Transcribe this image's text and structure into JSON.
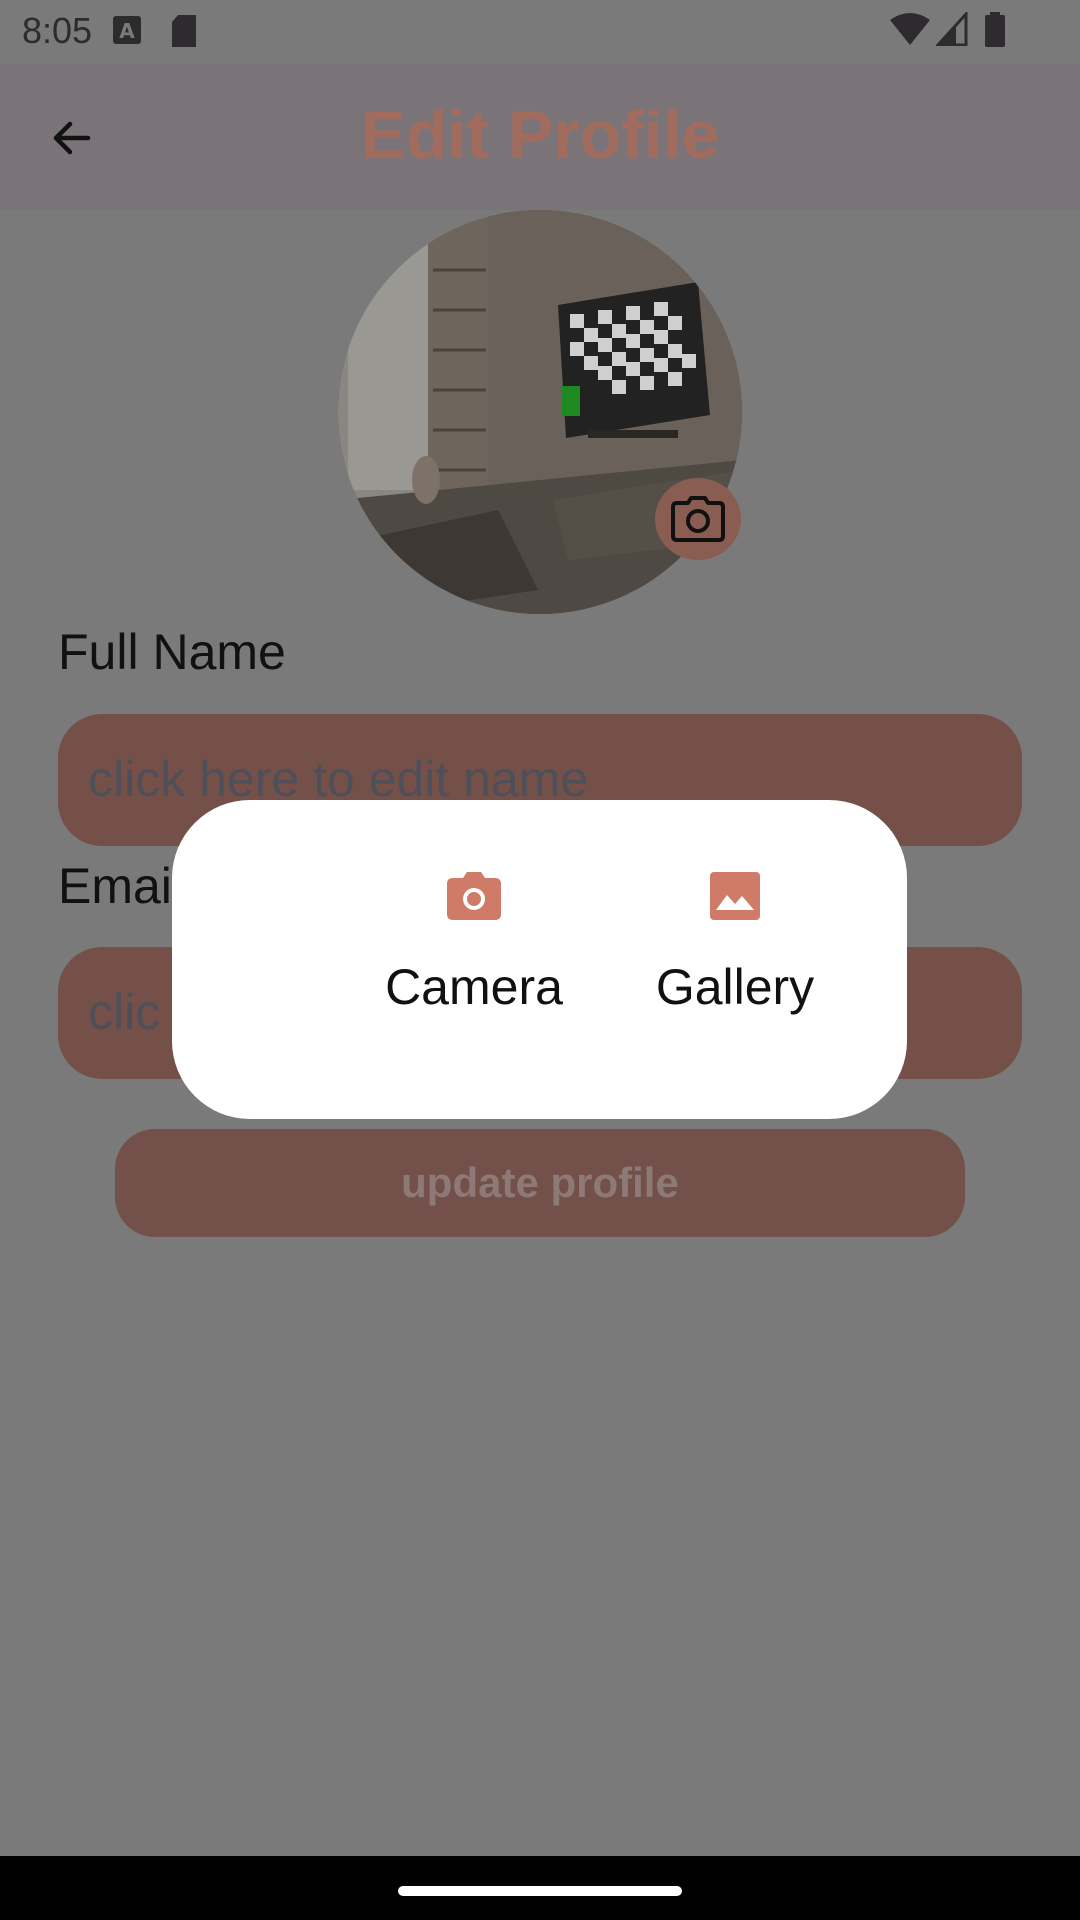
{
  "status_bar": {
    "time": "8:05",
    "icons": [
      "keyboard-a-icon",
      "sd-card-icon",
      "wifi-icon",
      "signal-icon",
      "battery-icon"
    ]
  },
  "app_bar": {
    "title": "Edit Profile",
    "back_icon": "arrow-back-icon"
  },
  "profile": {
    "camera_badge_icon": "camera-icon"
  },
  "form": {
    "full_name_label": "Full Name",
    "name_placeholder": "click here to edit name",
    "email_label": "Emai",
    "email_placeholder": "clic",
    "update_button": "update profile"
  },
  "image_source_dialog": {
    "options": [
      {
        "label": "Camera",
        "icon": "camera-icon"
      },
      {
        "label": "Gallery",
        "icon": "image-icon"
      }
    ]
  },
  "colors": {
    "accent": "#d07a68",
    "scrim": "#7a7a7a",
    "dialog_background": "#ffffff"
  }
}
